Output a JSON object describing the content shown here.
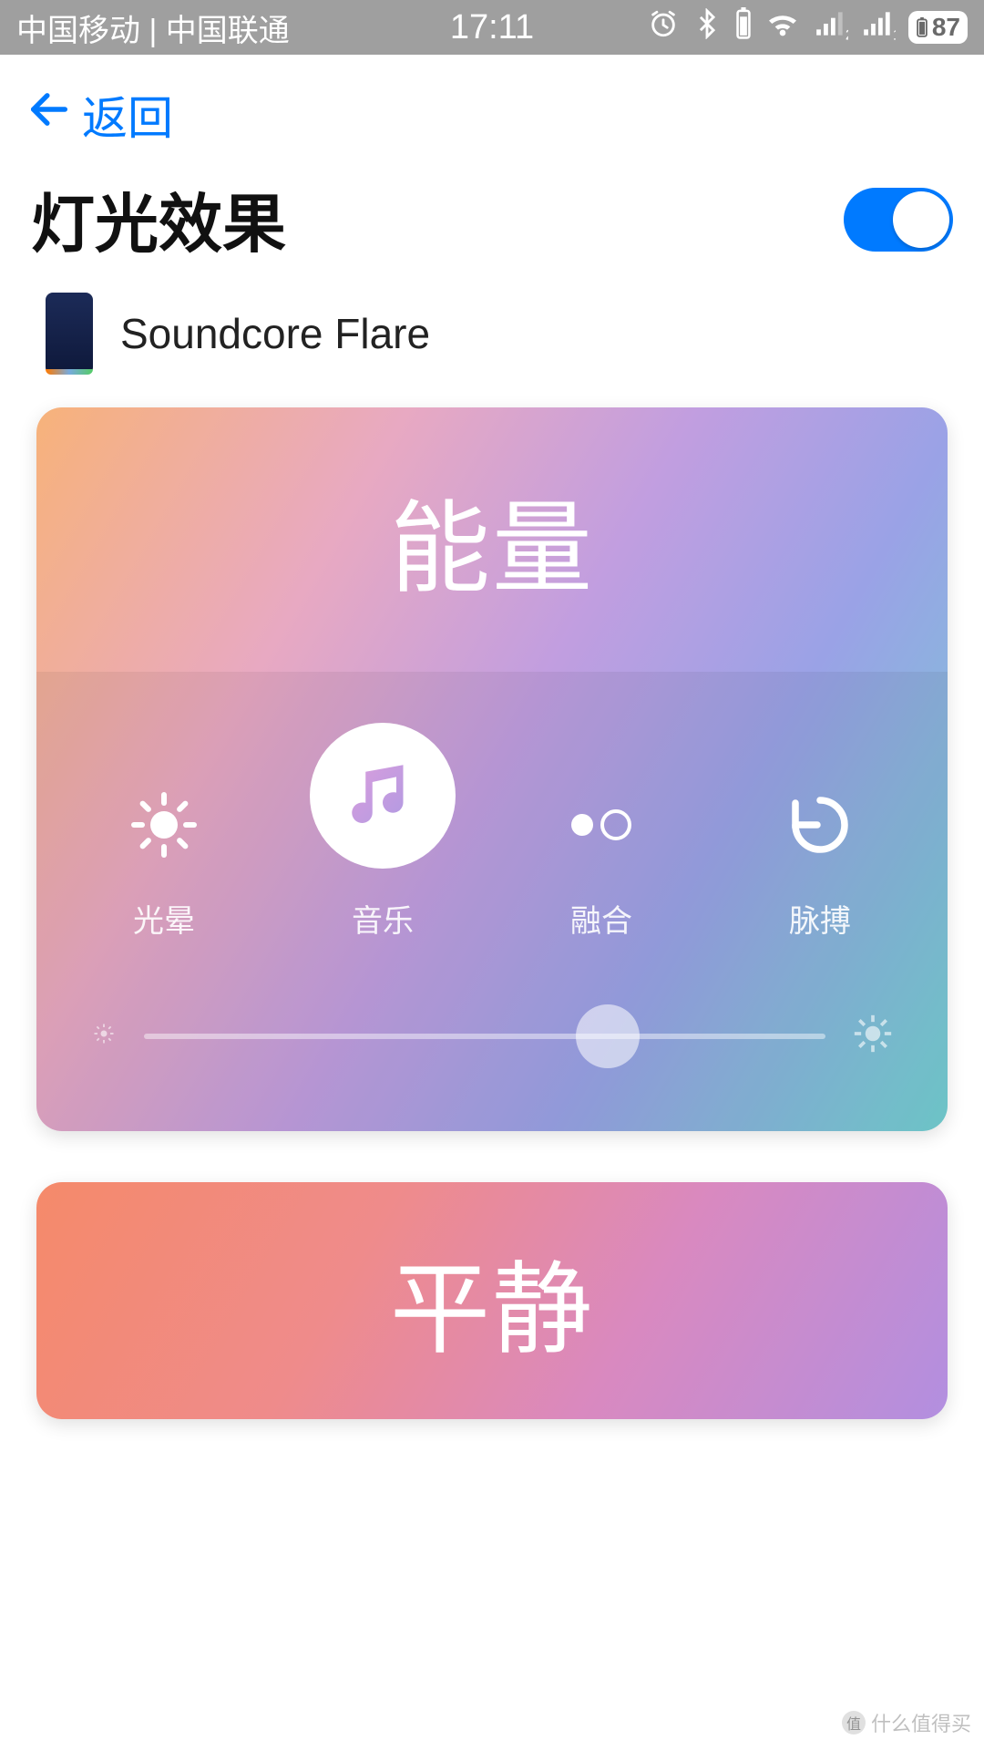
{
  "status": {
    "carriers": "中国移动 | 中国联通",
    "time": "17:11",
    "battery": "87"
  },
  "nav": {
    "back": "返回"
  },
  "page": {
    "title": "灯光效果",
    "toggle_on": true
  },
  "device": {
    "name": "Soundcore Flare"
  },
  "cards": {
    "energy": {
      "title": "能量",
      "modes": {
        "halo": "光晕",
        "music": "音乐",
        "fusion": "融合",
        "pulse": "脉搏"
      },
      "active_mode": "music",
      "brightness_pct": 68
    },
    "calm": {
      "title": "平静"
    }
  },
  "watermark": "什么值得买"
}
